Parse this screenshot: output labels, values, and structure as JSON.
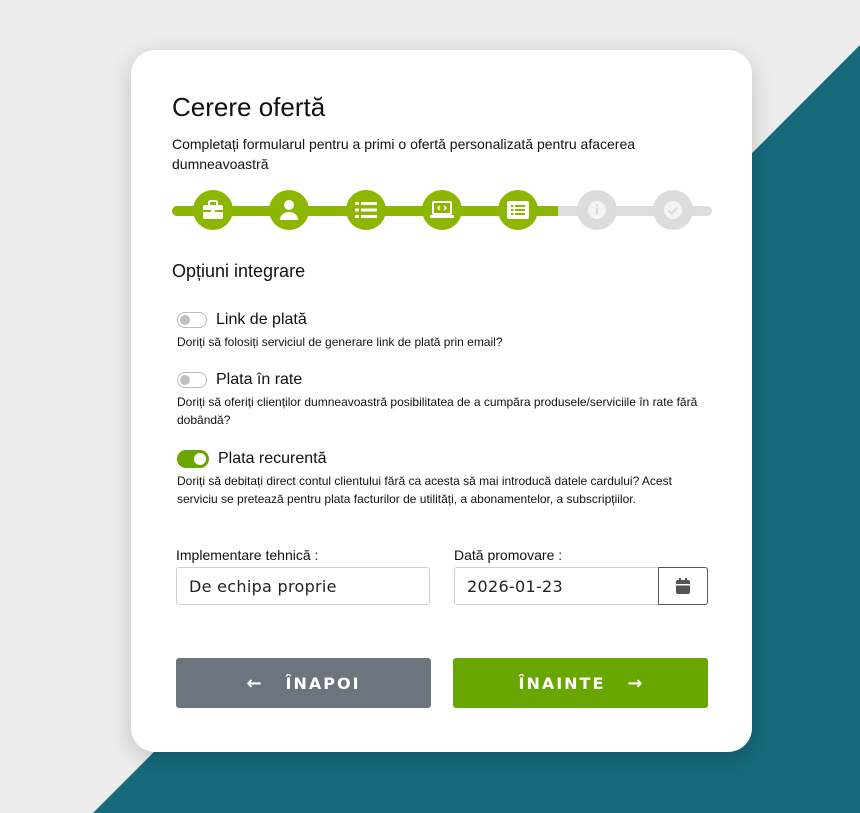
{
  "header": {
    "title": "Cerere ofertă",
    "subtitle": "Completați formularul pentru a primi o ofertă personalizată pentru afacerea dumneavoastră"
  },
  "stepper": {
    "completed_steps": 5,
    "total_steps": 7,
    "steps": [
      {
        "icon": "briefcase-icon",
        "state": "done"
      },
      {
        "icon": "user-icon",
        "state": "done"
      },
      {
        "icon": "list-icon",
        "state": "done"
      },
      {
        "icon": "laptop-code-icon",
        "state": "done"
      },
      {
        "icon": "list-alt-icon",
        "state": "current"
      },
      {
        "icon": "info-icon",
        "state": "pending"
      },
      {
        "icon": "check-icon",
        "state": "pending"
      }
    ],
    "active_color": "#8db600",
    "inactive_color": "#dddddd"
  },
  "section": {
    "title": "Opțiuni integrare"
  },
  "options": [
    {
      "label": "Link de plată",
      "description": "Doriți să folosiți serviciul de generare link de plată prin email?",
      "enabled": false
    },
    {
      "label": "Plata în rate",
      "description": "Doriți să oferiți clienților dumneavoastră posibilitatea de a cumpăra produsele/serviciile în rate fără dobândă?",
      "enabled": false
    },
    {
      "label": "Plata recurentă",
      "description": "Doriți să debitați direct contul clientului fără ca acesta să mai introducă datele cardului? Acest serviciu se pretează pentru plata facturilor de utilități, a abonamentelor, a subscripțiilor.",
      "enabled": true
    }
  ],
  "fields": {
    "implementation": {
      "label": "Implementare tehnică :",
      "value": "De echipa proprie"
    },
    "promo_date": {
      "label": "Dată promovare :",
      "value": "2026-01-23",
      "button_icon": "calendar-icon"
    }
  },
  "buttons": {
    "back": {
      "label": "ÎNAPOI",
      "arrow": "←",
      "color": "#6c757d"
    },
    "next": {
      "label": "ÎNAINTE",
      "arrow": "→",
      "color": "#6aa600"
    }
  }
}
